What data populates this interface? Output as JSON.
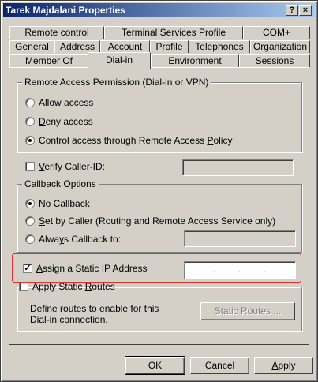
{
  "window": {
    "title": "Tarek Majdalani Properties",
    "help_glyph": "?",
    "close_glyph": "×"
  },
  "tabs": {
    "row1": [
      "Remote control",
      "Terminal Services Profile",
      "COM+"
    ],
    "row2": [
      "General",
      "Address",
      "Account",
      "Profile",
      "Telephones",
      "Organization"
    ],
    "row3": [
      "Member Of",
      "Dial-in",
      "Environment",
      "Sessions"
    ],
    "active": "Dial-in"
  },
  "remote_access": {
    "legend": "Remote Access Permission (Dial-in or VPN)",
    "allow": {
      "pre": "",
      "u": "A",
      "post": "llow access",
      "selected": false
    },
    "deny": {
      "pre": "",
      "u": "D",
      "post": "eny access",
      "selected": false
    },
    "policy": {
      "pre": "Control access through Remote Access ",
      "u": "P",
      "post": "olicy",
      "selected": true
    }
  },
  "verify": {
    "pre": "",
    "u": "V",
    "post": "erify Caller-ID:",
    "checked": false
  },
  "callback": {
    "legend": "Callback Options",
    "no": {
      "pre": "",
      "u": "N",
      "post": "o Callback",
      "selected": true
    },
    "set_by_caller": {
      "pre": "",
      "u": "S",
      "post": "et by Caller (Routing and Remote Access Service only)",
      "selected": false
    },
    "always": {
      "pre": "Alwa",
      "u": "y",
      "post": "s Callback to:",
      "selected": false
    }
  },
  "static_ip": {
    "pre": "",
    "u": "A",
    "post": "ssign a Static IP Address",
    "checked": true,
    "ip_dots": ".       .       ."
  },
  "static_routes": {
    "pre": "Apply Static ",
    "u": "R",
    "post": "outes",
    "checked": false,
    "description": "Define routes to enable for this Dial-in connection.",
    "button": "Static Routes ..."
  },
  "footer": {
    "ok": "OK",
    "cancel": "Cancel",
    "apply_pre": "",
    "apply_u": "A",
    "apply_post": "pply"
  },
  "colors": {
    "highlight_border": "#e03030",
    "title_start": "#0a246a",
    "title_end": "#a6caf0"
  }
}
